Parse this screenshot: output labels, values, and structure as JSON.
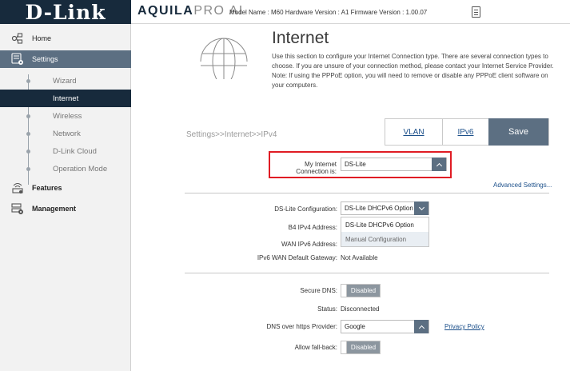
{
  "header": {
    "logo": "D-Link",
    "brand_bold": "AQUILA",
    "brand_light": "PRO AI",
    "model_info": "Model Name : M60 Hardware Version : A1 Firmware Version : 1.00.07"
  },
  "sidebar": {
    "items": [
      {
        "label": "Home",
        "icon": "home-network-icon"
      },
      {
        "label": "Settings",
        "icon": "settings-icon"
      },
      {
        "label": "Features",
        "icon": "wifi-features-icon"
      },
      {
        "label": "Management",
        "icon": "management-icon"
      }
    ],
    "sub_items": [
      {
        "label": "Wizard"
      },
      {
        "label": "Internet"
      },
      {
        "label": "Wireless"
      },
      {
        "label": "Network"
      },
      {
        "label": "D-Link Cloud"
      },
      {
        "label": "Operation Mode"
      }
    ]
  },
  "main": {
    "title": "Internet",
    "description": "Use this section to configure your Internet Connection type. There are several connection types to choose. If you are unsure of your connection method, please contact your Internet Service Provider. Note: If using the PPPoE option, you will need to remove or disable any PPPoE client software on your computers.",
    "breadcrumb": "Settings>>Internet>>IPv4",
    "tabs": {
      "vlan": "VLAN",
      "ipv6": "IPv6"
    },
    "save_label": "Save",
    "connection_label": "My Internet Connection is:",
    "connection_value": "DS-Lite",
    "advanced_link": "Advanced Settings...",
    "dslite_config_label": "DS-Lite Configuration:",
    "dslite_config_value": "DS-Lite DHCPv6 Option",
    "dslite_options": [
      "DS-Lite DHCPv6 Option",
      "Manual Configuration"
    ],
    "b4_label": "B4 IPv4 Address:",
    "wan_ipv6_label": "WAN IPv6 Address:",
    "gateway_label": "IPv6 WAN Default Gateway:",
    "gateway_value": "Not Available",
    "secure_dns_label": "Secure DNS:",
    "secure_dns_value": "Disabled",
    "status_label": "Status:",
    "status_value": "Disconnected",
    "doh_label": "DNS over https Provider:",
    "doh_value": "Google",
    "privacy_link": "Privacy Policy",
    "fallback_label": "Allow fall-back:",
    "fallback_value": "Disabled"
  },
  "colors": {
    "logo_bg": "#172a3c",
    "accent": "#5c6f82",
    "highlight_border": "#e01c24",
    "link": "#1b4f8a"
  }
}
